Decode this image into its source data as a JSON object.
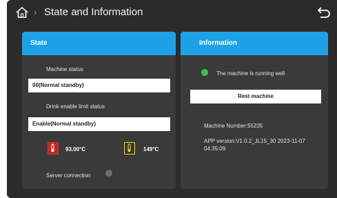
{
  "header": {
    "title": "State and Information"
  },
  "state_panel": {
    "title": "State",
    "machine_status_label": "Machine status",
    "machine_status_value": "00(Normal standby)",
    "drink_limit_label": "Drink enable limit status",
    "drink_limit_value": "Enable(Normal standby)",
    "hot_temp": "93.00°C",
    "cold_temp": "149°C",
    "server_connection_label": "Server connection"
  },
  "info_panel": {
    "title": "Information",
    "running_status": "The machine is running well",
    "reset_button": "Rest machine",
    "machine_number": "Machine Number:55235",
    "app_version_line1": "APP version:V1.0.2_JL15_30 2023-11-07",
    "app_version_line2": "04:35:09"
  },
  "colors": {
    "accent": "#1ea1e6",
    "running_dot": "#39c64a",
    "server_dot": "#6e6e6e",
    "hot": "#c02622",
    "cold": "#f2d31c"
  }
}
